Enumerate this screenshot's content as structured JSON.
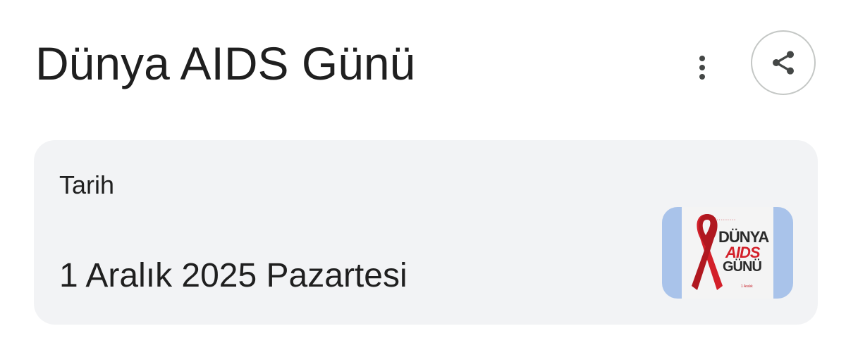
{
  "header": {
    "title": "Dünya AIDS Günü",
    "more_icon": "more-vert-icon",
    "share_icon": "share-icon"
  },
  "card": {
    "label": "Tarih",
    "date": "1 Aralık 2025 Pazartesi"
  },
  "thumbnail": {
    "line1": "DÜNYA",
    "line2": "AIDS",
    "line3": "GÜNÜ",
    "date": "1 Aralık",
    "ribbon_color": "#d3202a"
  },
  "colors": {
    "text": "#1f1f1f",
    "card_bg": "#f2f3f5",
    "icon": "#444746",
    "border": "#c4c7c5",
    "thumb_bg": "#a9c3ea"
  }
}
